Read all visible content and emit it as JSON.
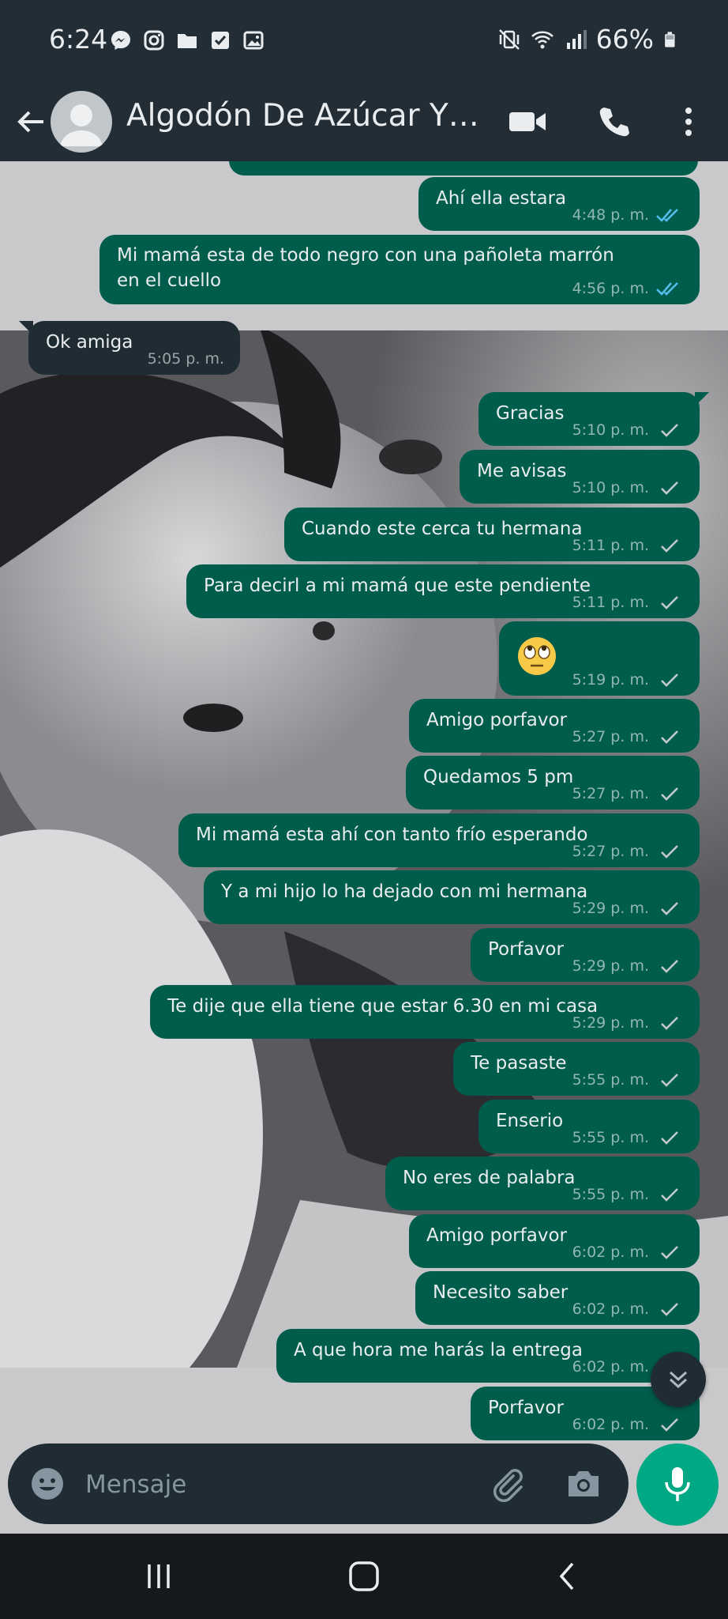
{
  "status_bar": {
    "time": "6:24",
    "battery": "66%",
    "left_icons": [
      "messenger-icon",
      "instagram-icon",
      "folder-icon",
      "checkbox-icon",
      "gallery-icon"
    ],
    "right_icons": [
      "vibrate-mute-icon",
      "wifi-icon",
      "signal-icon",
      "battery-icon"
    ]
  },
  "header": {
    "contact_name": "Algodón De Azúcar Y M...",
    "icons": [
      "back-arrow-icon",
      "video-call-icon",
      "phone-icon",
      "more-options-icon"
    ]
  },
  "messages": [
    {
      "dir": "out",
      "text": "",
      "time": "",
      "status": "partial"
    },
    {
      "dir": "out",
      "text": "Ahí ella estara",
      "time": "4:48 p. m.",
      "status": "read"
    },
    {
      "dir": "out",
      "text": "Mi mamá esta de todo negro con una pañoleta marrón en el cuello",
      "time": "4:56 p. m.",
      "status": "read"
    },
    {
      "dir": "in",
      "text": "Ok amiga",
      "time": "5:05 p. m.",
      "status": ""
    },
    {
      "dir": "out",
      "text": "Gracias",
      "time": "5:10 p. m.",
      "status": "sent"
    },
    {
      "dir": "out",
      "text": "Me avisas",
      "time": "5:10 p. m.",
      "status": "sent"
    },
    {
      "dir": "out",
      "text": "Cuando este cerca tu hermana",
      "time": "5:11 p. m.",
      "status": "sent"
    },
    {
      "dir": "out",
      "text": "Para decirl a mi mamá que este pendiente",
      "time": "5:11 p. m.",
      "status": "sent"
    },
    {
      "dir": "out",
      "text": "",
      "emoji": "face-with-rolling-eyes",
      "time": "5:19 p. m.",
      "status": "sent"
    },
    {
      "dir": "out",
      "text": "Amigo porfavor",
      "time": "5:27 p. m.",
      "status": "sent"
    },
    {
      "dir": "out",
      "text": "Quedamos 5 pm",
      "time": "5:27 p. m.",
      "status": "sent"
    },
    {
      "dir": "out",
      "text": "Mi mamá esta ahí con tanto frío esperando",
      "time": "5:27 p. m.",
      "status": "sent"
    },
    {
      "dir": "out",
      "text": "Y a mi hijo lo ha dejado con mi hermana",
      "time": "5:29 p. m.",
      "status": "sent"
    },
    {
      "dir": "out",
      "text": "Porfavor",
      "time": "5:29 p. m.",
      "status": "sent"
    },
    {
      "dir": "out",
      "text": "Te dije que ella tiene que estar 6.30 en mi casa",
      "time": "5:29 p. m.",
      "status": "sent"
    },
    {
      "dir": "out",
      "text": "Te pasaste",
      "time": "5:55 p. m.",
      "status": "sent"
    },
    {
      "dir": "out",
      "text": "Enserio",
      "time": "5:55 p. m.",
      "status": "sent"
    },
    {
      "dir": "out",
      "text": "No eres de palabra",
      "time": "5:55 p. m.",
      "status": "sent"
    },
    {
      "dir": "out",
      "text": "Amigo porfavor",
      "time": "6:02 p. m.",
      "status": "sent"
    },
    {
      "dir": "out",
      "text": "Necesito saber",
      "time": "6:02 p. m.",
      "status": "sent"
    },
    {
      "dir": "out",
      "text": "A que hora me harás la entrega",
      "time": "6:02 p. m.",
      "status": "sent"
    },
    {
      "dir": "out",
      "text": "Porfavor",
      "time": "6:02 p. m.",
      "status": "sent"
    }
  ],
  "composer": {
    "placeholder": "Mensaje",
    "icons": [
      "emoji-icon",
      "attach-icon",
      "camera-icon",
      "mic-icon"
    ]
  },
  "nav_bar": {
    "icons": [
      "recents-icon",
      "home-icon",
      "back-icon"
    ]
  },
  "colors": {
    "header_bg": "#232d36",
    "outgoing_bubble": "#005c4b",
    "incoming_bubble": "#202c33",
    "read_ticks": "#53bdeb",
    "mic_button": "#00a884"
  }
}
